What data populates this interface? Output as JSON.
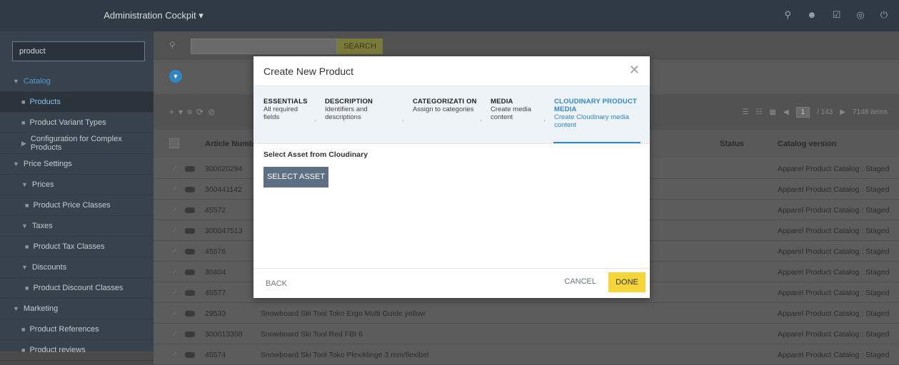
{
  "topbar": {
    "title": "Administration Cockpit ▾",
    "icons": [
      "sync-icon",
      "user-settings-icon",
      "checklist-icon",
      "help-icon",
      "power-icon"
    ]
  },
  "sidebar": {
    "search_value": "product",
    "items": [
      {
        "label": "Catalog",
        "kind": "section",
        "state": "active"
      },
      {
        "label": "Products",
        "kind": "sub",
        "state": "selected"
      },
      {
        "label": "Product Variant Types",
        "kind": "sub"
      },
      {
        "label": "Configuration for Complex Products",
        "kind": "sub"
      },
      {
        "label": "Price Settings",
        "kind": "section"
      },
      {
        "label": "Prices",
        "kind": "sub"
      },
      {
        "label": "Product Price Classes",
        "kind": "sub2"
      },
      {
        "label": "Taxes",
        "kind": "sub"
      },
      {
        "label": "Product Tax Classes",
        "kind": "sub2"
      },
      {
        "label": "Discounts",
        "kind": "sub"
      },
      {
        "label": "Product Discount Classes",
        "kind": "sub2"
      },
      {
        "label": "Marketing",
        "kind": "section"
      },
      {
        "label": "Product References",
        "kind": "sub"
      },
      {
        "label": "Product reviews",
        "kind": "sub"
      }
    ]
  },
  "toolbar": {
    "search_label": "SEARCH"
  },
  "pager": {
    "page": "1",
    "of": "/ 143",
    "items": "7148 items"
  },
  "table": {
    "headers": {
      "article": "Article Numb...",
      "status": "Status",
      "catalog": "Catalog version"
    },
    "rows": [
      {
        "article": "300020294",
        "name": "",
        "catalog": "Apparel Product Catalog : Staged"
      },
      {
        "article": "300441142",
        "name": "",
        "catalog": "Apparel Product Catalog : Staged"
      },
      {
        "article": "45572",
        "name": "",
        "catalog": "Apparel Product Catalog : Staged"
      },
      {
        "article": "300047513",
        "name": "",
        "catalog": "Apparel Product Catalog : Staged"
      },
      {
        "article": "45576",
        "name": "",
        "catalog": "Apparel Product Catalog : Staged"
      },
      {
        "article": "30404",
        "name": "",
        "catalog": "Apparel Product Catalog : Staged"
      },
      {
        "article": "45577",
        "name": "",
        "catalog": "Apparel Product Catalog : Staged"
      },
      {
        "article": "29533",
        "name": "Snowboard Ski Tool Toko Ergo Multi Guide yellow",
        "catalog": "Apparel Product Catalog : Staged"
      },
      {
        "article": "300013358",
        "name": "Snowboard Ski Tool Red FBI 6",
        "catalog": "Apparel Product Catalog : Staged"
      },
      {
        "article": "45574",
        "name": "Snowboard Ski Tool Toko Plexiklinge 3 mm/flexibel",
        "catalog": "Apparel Product Catalog : Staged"
      }
    ]
  },
  "dialog": {
    "title": "Create New Product",
    "steps": [
      {
        "title": "ESSENTIALS",
        "desc": "All required fields"
      },
      {
        "title": "DESCRIPTION",
        "desc": "Identifiers and descriptions"
      },
      {
        "title": "CATEGORIZATI ON",
        "desc": "Assign to categories"
      },
      {
        "title": "MEDIA",
        "desc": "Create media content"
      },
      {
        "title": "CLOUDINARY PRODUCT MEDIA",
        "desc": "Create Cloudinary media content"
      }
    ],
    "body_label": "Select Asset from Cloudinary",
    "select_asset": "SELECT ASSET",
    "back": "BACK",
    "cancel": "CANCEL",
    "done": "DONE"
  }
}
